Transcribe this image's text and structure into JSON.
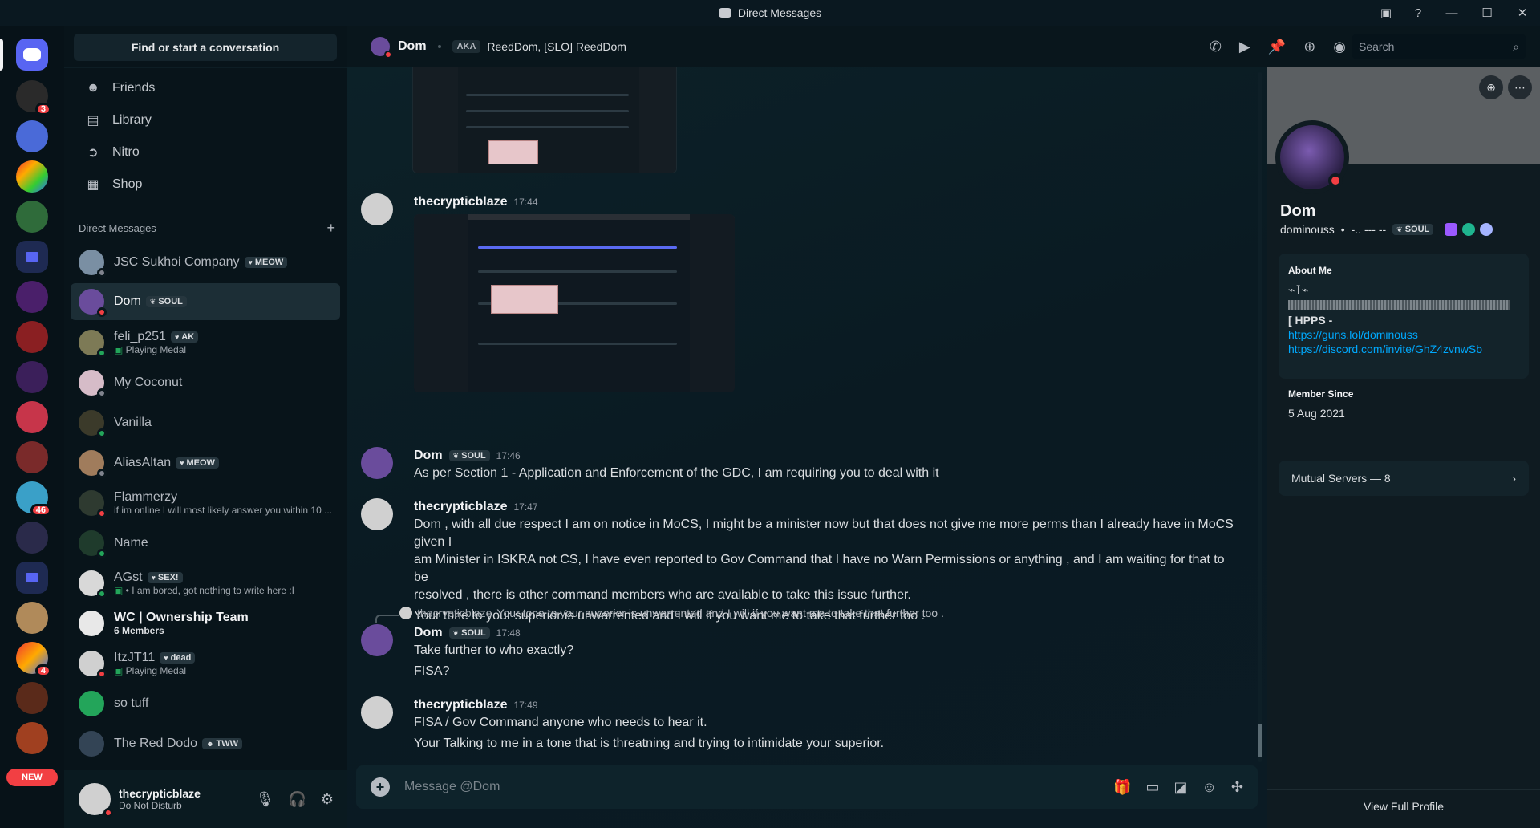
{
  "window": {
    "title": "Direct Messages",
    "icons": [
      "inbox-icon",
      "help-icon",
      "minimize-icon",
      "maximize-icon",
      "close-icon"
    ]
  },
  "rail": {
    "badges": {
      "server2": "3",
      "server11": "46",
      "server16": "4"
    },
    "new_label": "NEW"
  },
  "dm_column": {
    "search_label": "Find or start a conversation",
    "nav": [
      {
        "label": "Friends",
        "icon": "friends-icon"
      },
      {
        "label": "Library",
        "icon": "library-icon"
      },
      {
        "label": "Nitro",
        "icon": "nitro-icon"
      },
      {
        "label": "Shop",
        "icon": "shop-icon"
      }
    ],
    "dm_header": "Direct Messages",
    "dms": [
      {
        "name": "JSC Sukhoi Company",
        "tag": "MEOW",
        "sub": "",
        "game": "",
        "status": "offline",
        "color": "#7a8fa3"
      },
      {
        "name": "Dom",
        "tag": "SOUL",
        "sub": "",
        "game": "",
        "status": "dnd",
        "color": "#6a4c9c",
        "active": true
      },
      {
        "name": "feli_p251",
        "tag": "AK",
        "sub": "",
        "game": "Playing Medal",
        "status": "online",
        "color": "#7d7a56"
      },
      {
        "name": "My Coconut",
        "tag": "",
        "sub": "",
        "game": "",
        "status": "offline",
        "color": "#d6bcc8"
      },
      {
        "name": "Vanilla",
        "tag": "",
        "sub": "",
        "game": "",
        "status": "online",
        "color": "#3b3a2a"
      },
      {
        "name": "AliasAltan",
        "tag": "MEOW",
        "sub": "",
        "game": "",
        "status": "offline",
        "color": "#a07c5c"
      },
      {
        "name": "Flammerzy",
        "tag": "",
        "sub": "if im online I will most likely answer you within 10 ...",
        "game": "",
        "status": "dnd",
        "color": "#2e3a30"
      },
      {
        "name": "Name",
        "tag": "",
        "sub": "",
        "game": "",
        "status": "online",
        "color": "#1f3b2c"
      },
      {
        "name": "AGst",
        "tag": "SEX!",
        "sub": " • I am bored, got nothing to write here :I",
        "game": "",
        "status": "online",
        "color": "#d8d8d8"
      },
      {
        "name": "WC | Ownership Team",
        "tag": "",
        "sub": "6 Members",
        "game": "",
        "status": "none",
        "color": "#e8e8e8",
        "bright": true
      },
      {
        "name": "ItzJT11",
        "tag": "dead",
        "sub": "",
        "game": "Playing Medal",
        "status": "dnd",
        "color": "#d0d0d0"
      },
      {
        "name": "so tuff",
        "tag": "",
        "sub": "",
        "game": "",
        "status": "none",
        "color": "#23a55a"
      },
      {
        "name": "The Red Dodo",
        "tag": "TWW",
        "sub": "",
        "game": "",
        "status": "none",
        "color": "#334455"
      }
    ],
    "user": {
      "name": "thecrypticblaze",
      "status": "Do Not Disturb"
    }
  },
  "chat_header": {
    "name": "Dom",
    "aka_label": "AKA",
    "aliases": "ReedDom, [SLO] ReedDom",
    "search_placeholder": "Search"
  },
  "messages": [
    {
      "author": "thecrypticblaze",
      "time": "17:44",
      "lines": []
    },
    {
      "author": "Dom",
      "tag": "SOUL",
      "time": "17:46",
      "lines": [
        "As per Section 1 - Application and Enforcement of the GDC, I am requiring you to deal with it"
      ]
    },
    {
      "author": "thecrypticblaze",
      "time": "17:47",
      "lines": [
        "Dom , with all due respect I am on notice in MoCS,  I might be a minister now but that does not give me more perms than I already have in MoCS given I",
        "am Minister in ISKRA not CS, I have even reported to Gov Command that I have no Warn Permissions or anything , and I am waiting for that to be",
        "resolved , there is other command members who are available to take this issue further.",
        "Your tone to your superior is unwarrented and I will if you want me to take that further too ."
      ]
    },
    {
      "reply_to": "thecrypticblaze",
      "reply_text": "Your tone to your superior is unwarrented and I will if you want me to take that further too .",
      "author": "Dom",
      "tag": "SOUL",
      "time": "17:48",
      "lines": [
        "Take further to who exactly?",
        "FISA?"
      ]
    },
    {
      "author": "thecrypticblaze",
      "time": "17:49",
      "lines": [
        "FISA / Gov Command anyone who needs to hear it.",
        "Your Talking to me in a tone that is threatning and trying to intimidate your superior."
      ]
    }
  ],
  "composer": {
    "placeholder": "Message @Dom"
  },
  "profile": {
    "name": "Dom",
    "handle": "dominouss",
    "handle_extra": "-.. --- --",
    "tag": "SOUL",
    "about_title": "About Me",
    "about_glyphs": "⌁⍑⌁",
    "about_heading": "[ HPPS -",
    "links": [
      "https://guns.lol/dominouss",
      "https://discord.com/invite/GhZ4zvnwSb"
    ],
    "member_since_title": "Member Since",
    "member_since": "5 Aug 2021",
    "mutual_servers": "Mutual Servers — 8",
    "view_full": "View Full Profile"
  }
}
